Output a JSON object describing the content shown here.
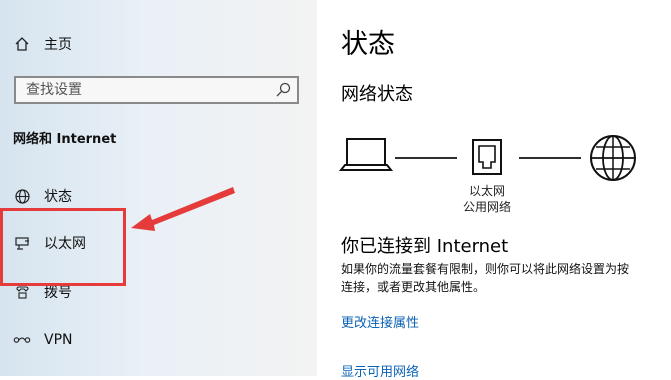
{
  "sidebar": {
    "home_label": "主页",
    "search_placeholder": "查找设置",
    "section_title": "网络和 Internet",
    "items": [
      {
        "label": "状态",
        "icon": "globe-icon"
      },
      {
        "label": "以太网",
        "icon": "ethernet-icon"
      },
      {
        "label": "拨号",
        "icon": "phone-icon"
      },
      {
        "label": "VPN",
        "icon": "vpn-icon"
      }
    ]
  },
  "highlight_color": "#e53b3b",
  "main": {
    "title": "状态",
    "network_status": "网络状态",
    "diagram": {
      "adapter_label": "以太网",
      "network_type": "公用网络"
    },
    "connected_heading": "你已连接到 Internet",
    "description_line1": "如果你的流量套餐有限制，则你可以将此网络设置为按",
    "description_line2": "连接，或者更改其他属性。",
    "link_change_properties": "更改连接属性",
    "link_show_networks": "显示可用网络"
  },
  "colors": {
    "link": "#0a62b5",
    "sidebar_bg": "#e9f0f6"
  }
}
